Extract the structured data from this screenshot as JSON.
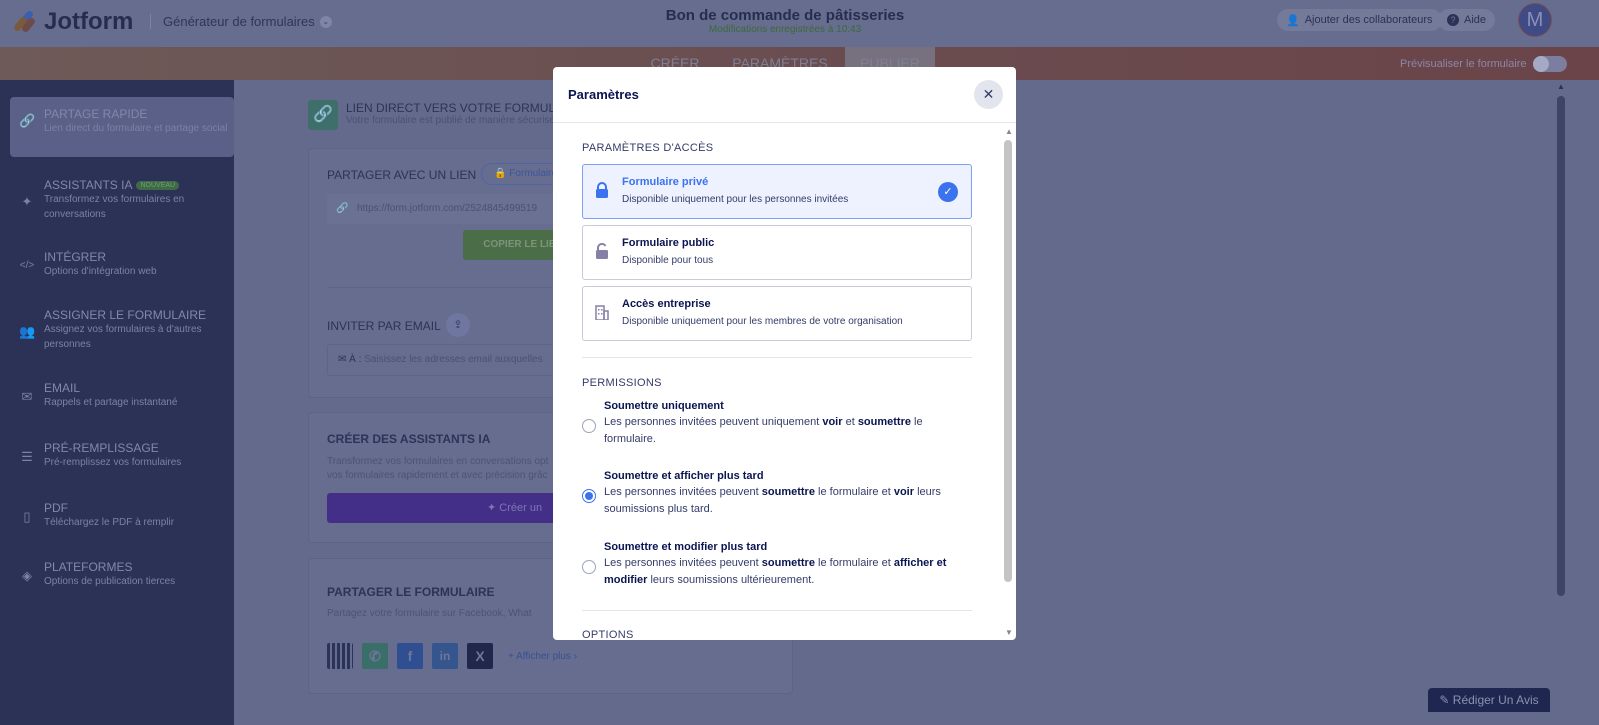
{
  "header": {
    "brand": "Jotform",
    "builder_label": "Générateur de formulaires",
    "form_title": "Bon de commande de pâtisseries",
    "save_status": "Modifications enregistrées à 10:43",
    "collaborators_button": "Ajouter des collaborateurs",
    "help_button": "Aide",
    "avatar_initial": "M"
  },
  "tabs": [
    {
      "label": "CRÉER"
    },
    {
      "label": "PARAMÈTRES"
    },
    {
      "label": "PUBLIER",
      "active": true
    }
  ],
  "preview_toggle": {
    "label": "Prévisualiser le formulaire",
    "on": false
  },
  "sidebar": {
    "items": [
      {
        "title": "PARTAGE RAPIDE",
        "desc": "Lien direct du formulaire et partage social",
        "icon": "link-icon",
        "active": true
      },
      {
        "title": "ASSISTANTS IA",
        "badge": "NOUVEAU",
        "desc": "Transformez vos formulaires en conversations",
        "icon": "sparkle-icon"
      },
      {
        "title": "INTÉGRER",
        "desc": "Options d'intégration web",
        "icon": "code-icon"
      },
      {
        "title": "ASSIGNER LE FORMULAIRE",
        "desc": "Assignez vos formulaires à d'autres personnes",
        "icon": "users-icon"
      },
      {
        "title": "EMAIL",
        "desc": "Rappels et partage instantané",
        "icon": "envelope-icon"
      },
      {
        "title": "PRÉ-REMPLISSAGE",
        "desc": "Pré-remplissez vos formulaires",
        "icon": "prefill-icon"
      },
      {
        "title": "PDF",
        "desc": "Téléchargez le PDF à remplir",
        "icon": "pdf-icon"
      },
      {
        "title": "PLATEFORMES",
        "desc": "Options de publication tierces",
        "icon": "layers-icon"
      }
    ]
  },
  "main": {
    "direct_link": {
      "title": "LIEN DIRECT VERS VOTRE FORMULAIRE",
      "desc": "Votre formulaire est publié de manière sécurisée"
    },
    "share_link": {
      "title": "PARTAGER AVEC UN LIEN",
      "badge": "Formulaire",
      "url": "https://form.jotform.com/2524845499519",
      "copy_button": "COPIER LE LIEN"
    },
    "invite": {
      "title": "INVITER PAR EMAIL",
      "to_label": "À :",
      "placeholder": "Saisissez les adresses email auxquelles"
    },
    "ai": {
      "title": "CRÉER DES ASSISTANTS IA",
      "desc1": "Transformez vos formulaires en conversations opt",
      "desc2": "vos formulaires rapidement et avec précision grâc",
      "button": "Créer un"
    },
    "share_form": {
      "title": "PARTAGER LE FORMULAIRE",
      "desc": "Partagez votre formulaire sur Facebook, What",
      "show_more": "Afficher plus"
    }
  },
  "modal": {
    "title": "Paramètres",
    "access_title": "PARAMÈTRES D'ACCÈS",
    "access_options": [
      {
        "title": "Formulaire privé",
        "desc": "Disponible uniquement pour les personnes invitées",
        "selected": true
      },
      {
        "title": "Formulaire public",
        "desc": "Disponible pour tous"
      },
      {
        "title": "Accès entreprise",
        "desc": "Disponible uniquement pour les membres de votre organisation"
      }
    ],
    "permissions_title": "PERMISSIONS",
    "permissions": [
      {
        "title": "Soumettre uniquement",
        "d": [
          "Les personnes invitées peuvent uniquement ",
          "voir",
          " et ",
          "soumettre",
          " le formulaire."
        ]
      },
      {
        "title": "Soumettre et afficher plus tard",
        "selected": true,
        "d": [
          "Les personnes invitées peuvent ",
          "soumettre",
          " le formulaire et ",
          "voir",
          " leurs soumissions plus tard."
        ]
      },
      {
        "title": "Soumettre et modifier plus tard",
        "d": [
          "Les personnes invitées peuvent ",
          "soumettre",
          " le formulaire et ",
          "afficher et modifier",
          " leurs soumissions ultérieurement."
        ]
      }
    ],
    "options_title": "OPTIONS"
  },
  "review_button": "Rédiger Un Avis",
  "colors": {
    "accent": "#3b73ef",
    "modal_text": "#0a1551"
  }
}
